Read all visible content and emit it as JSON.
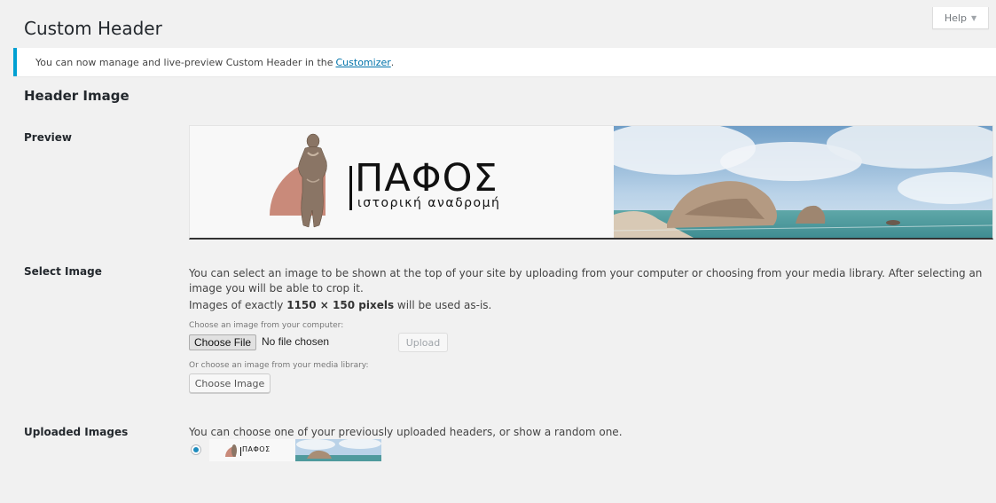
{
  "header": {
    "title": "Custom Header",
    "help_label": "Help"
  },
  "notice": {
    "text": "You can now manage and live-preview Custom Header in the",
    "link": "Customizer",
    "end": "."
  },
  "section": {
    "title": "Header Image"
  },
  "preview": {
    "label": "Preview",
    "logo_main": "ΠΑΦΟΣ",
    "logo_sub": "ιστορική αναδρομή"
  },
  "select_image": {
    "label": "Select Image",
    "description": "You can select an image to be shown at the top of your site by uploading from your computer or choosing from your media library. After selecting an image you will be able to crop it.",
    "size_prefix": "Images of exactly ",
    "size_value": "1150 × 150 pixels",
    "size_suffix": " will be used as-is.",
    "computer_label": "Choose an image from your computer:",
    "choose_file": "Choose File",
    "no_file": "No file chosen",
    "upload": "Upload",
    "library_label": "Or choose an image from your media library:",
    "choose_image": "Choose Image"
  },
  "uploaded": {
    "label": "Uploaded Images",
    "description": "You can choose one of your previously uploaded headers, or show a random one.",
    "thumb_logo": "ΠΑΦΟΣ",
    "selected": true
  },
  "colors": {
    "accent": "#0073aa",
    "notice_border": "#00a0d2",
    "background": "#f1f1f1"
  }
}
